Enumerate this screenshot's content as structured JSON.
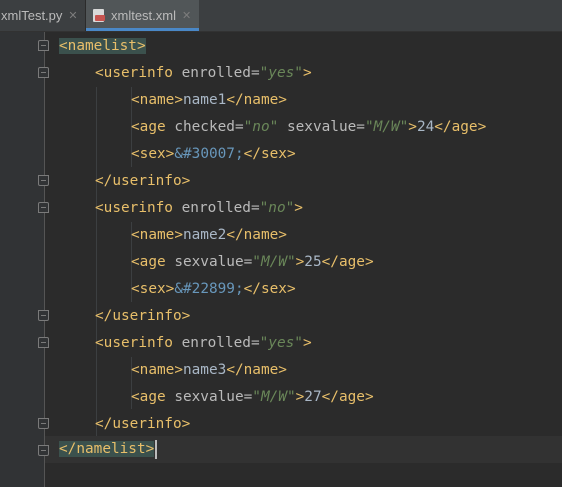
{
  "tabs": [
    {
      "label": "xmlTest.py",
      "close": "✕"
    },
    {
      "label": "xmltest.xml",
      "close": "✕",
      "icon": "xml-file-icon",
      "active": true
    }
  ],
  "colors": {
    "background": "#2b2b2b",
    "tag": "#e8bf6a",
    "attribute": "#bababa",
    "value": "#6a8759",
    "entity": "#6897bb",
    "text": "#a9b7c6"
  },
  "code": {
    "l1": {
      "open": "<namelist>"
    },
    "l2": {
      "pre": "<userinfo",
      "attr": " enrolled=",
      "val": "\"yes\"",
      "post": ">"
    },
    "l3": {
      "open": "<name>",
      "text": "name1",
      "close": "</name>"
    },
    "l4": {
      "pre": "<age",
      "attr1": " checked=",
      "val1": "\"no\"",
      "attr2": " sexvalue=",
      "val2": "\"M/W\"",
      "mid": ">",
      "text": "24",
      "close": "</age>"
    },
    "l5": {
      "open": "<sex>",
      "entity": "&#30007;",
      "close": "</sex>"
    },
    "l6": {
      "close": "</userinfo>"
    },
    "l7": {
      "pre": "<userinfo",
      "attr": " enrolled=",
      "val": "\"no\"",
      "post": ">"
    },
    "l8": {
      "open": "<name>",
      "text": "name2",
      "close": "</name>"
    },
    "l9": {
      "pre": "<age",
      "attr": " sexvalue=",
      "val": "\"M/W\"",
      "mid": ">",
      "text": "25",
      "close": "</age>"
    },
    "l10": {
      "open": "<sex>",
      "entity": "&#22899;",
      "close": "</sex>"
    },
    "l11": {
      "close": "</userinfo>"
    },
    "l12": {
      "pre": "<userinfo",
      "attr": " enrolled=",
      "val": "\"yes\"",
      "post": ">"
    },
    "l13": {
      "open": "<name>",
      "text": "name3",
      "close": "</name>"
    },
    "l14": {
      "pre": "<age",
      "attr": " sexvalue=",
      "val": "\"M/W\"",
      "mid": ">",
      "text": "27",
      "close": "</age>"
    },
    "l15": {
      "close": "</userinfo>"
    },
    "l16": {
      "close": "</namelist>"
    }
  }
}
